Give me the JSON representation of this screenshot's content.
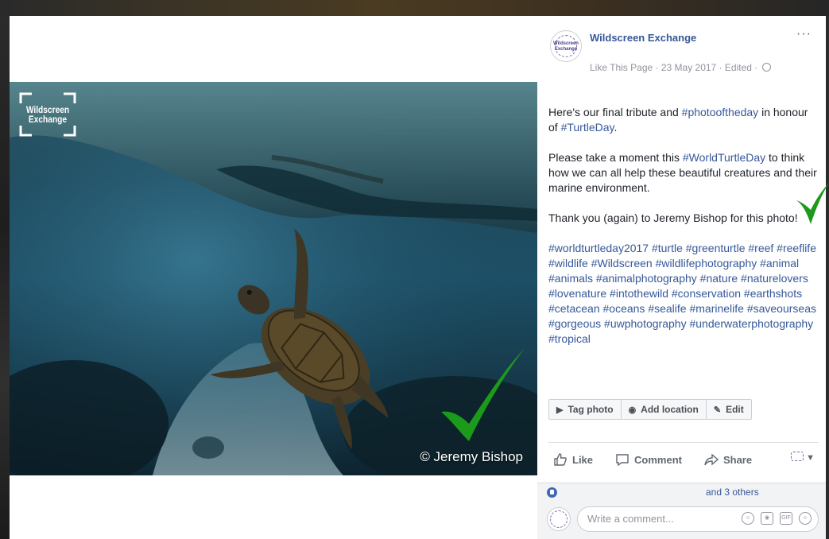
{
  "post": {
    "page_name": "Wildscreen Exchange",
    "avatar_line1": "Wildscreen",
    "avatar_line2": "Exchange",
    "more_label": "···",
    "like_page": "Like This Page",
    "sep": " · ",
    "date": "23 May 2017",
    "edited": "Edited",
    "text": {
      "p1_prefix": "Here's our final tribute and ",
      "p1_tag1": "#photooftheday",
      "p1_mid": " in honour of ",
      "p1_tag2": "#TurtleDay",
      "p1_suffix": ".",
      "p2_prefix": "Please take a moment this ",
      "p2_tag": "#WorldTurtleDay",
      "p2_suffix": " to think how we can all help these beautiful creatures and their marine environment.",
      "p3": "Thank you (again) to Jeremy Bishop for this photo!",
      "hashtags": "#worldturtleday2017 #turtle #greenturtle #reef #reeflife #wildlife #Wildscreen #wildlifephotography #animal #animals #animalphotography #nature #naturelovers #lovenature #intothewild #conservation #earthshots #cetacean #oceans #sealife #marinelife #saveourseas #gorgeous #uwphotography #underwaterphotography #tropical"
    }
  },
  "photo": {
    "logo_line1": "Wildscreen",
    "logo_line2": "Exchange",
    "credit": "© Jeremy Bishop"
  },
  "photo_actions": {
    "tag": "Tag photo",
    "location": "Add location",
    "edit": "Edit"
  },
  "reactions": {
    "like": "Like",
    "comment": "Comment",
    "share": "Share"
  },
  "likes": {
    "others": "and 3 others"
  },
  "comment": {
    "placeholder": "Write a comment..."
  },
  "colors": {
    "link": "#365899",
    "check": "#1c8c1c",
    "fb_blue": "#4267b2"
  }
}
